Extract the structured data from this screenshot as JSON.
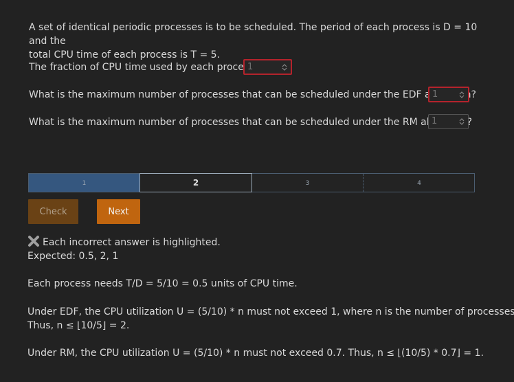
{
  "intro": {
    "line1": "A set of identical periodic processes is to be scheduled. The period of each process is D = 10 and the",
    "line2": "total CPU time of each process is T = 5."
  },
  "questions": [
    {
      "label": "The fraction of CPU time used by each process is",
      "value": "1"
    },
    {
      "label": "What is the maximum number of processes that can be scheduled under the EDF algorithm?",
      "value": "1"
    },
    {
      "label": "What is the maximum number of processes that can be scheduled under the RM algorithm?",
      "value": "1"
    }
  ],
  "progress": {
    "segments": [
      "1",
      "2",
      "3",
      "4"
    ],
    "current": 2
  },
  "buttons": {
    "check": "Check",
    "next": "Next"
  },
  "feedback": {
    "status": "Each incorrect answer is highlighted.",
    "expected": "Expected: 0.5, 2, 1",
    "explanation1": "Each process needs T/D = 5/10 = 0.5 units of CPU time.",
    "explanation2a": "Under EDF, the CPU utilization U = (5/10) * n must not exceed 1, where n is the number of processes.",
    "explanation2b": "Thus, n ≤ ⌊10/5⌋ = 2.",
    "explanation3": "Under RM, the CPU utilization U = (5/10) * n must not exceed 0.7. Thus, n ≤ ⌊(10/5) * 0.7⌋ = 1."
  },
  "colors": {
    "background": "#222222",
    "error": "#b4232c",
    "next": "#c0650f",
    "progress": "#35577f"
  }
}
